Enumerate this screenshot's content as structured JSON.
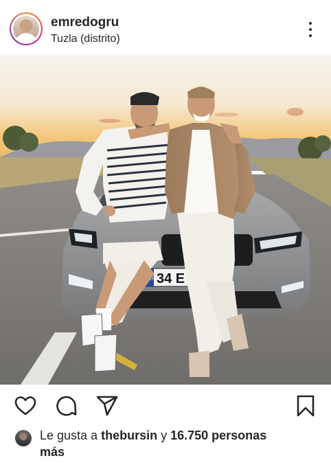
{
  "post": {
    "username": "emredogru",
    "location": "Tuzla (distrito)"
  },
  "photo": {
    "license_plate": "34 E",
    "plate_country": "TR"
  },
  "actions": {
    "like_icon": "heart-icon",
    "comment_icon": "comment-icon",
    "share_icon": "send-icon",
    "save_icon": "bookmark-icon"
  },
  "likes": {
    "prefix": "Le gusta a ",
    "user": "thebursin",
    "middle": " y ",
    "count": "16.750 personas",
    "suffix": "más"
  },
  "colors": {
    "text": "#262626",
    "sky_top": "#f3f1ea",
    "sky_horizon": "#f2b35a",
    "car": "#8b8e91"
  }
}
